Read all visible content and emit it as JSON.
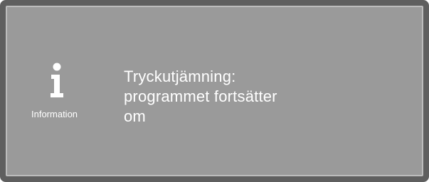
{
  "dialog": {
    "icon": "info-icon",
    "icon_label": "Information",
    "message_lines": [
      "Tryckutjämning:",
      "programmet fortsätter",
      "om"
    ]
  },
  "colors": {
    "bezel": "#5f5f5f",
    "screen_background": "#9a9a9a",
    "screen_border": "#bdbdbd",
    "text": "#ffffff"
  }
}
